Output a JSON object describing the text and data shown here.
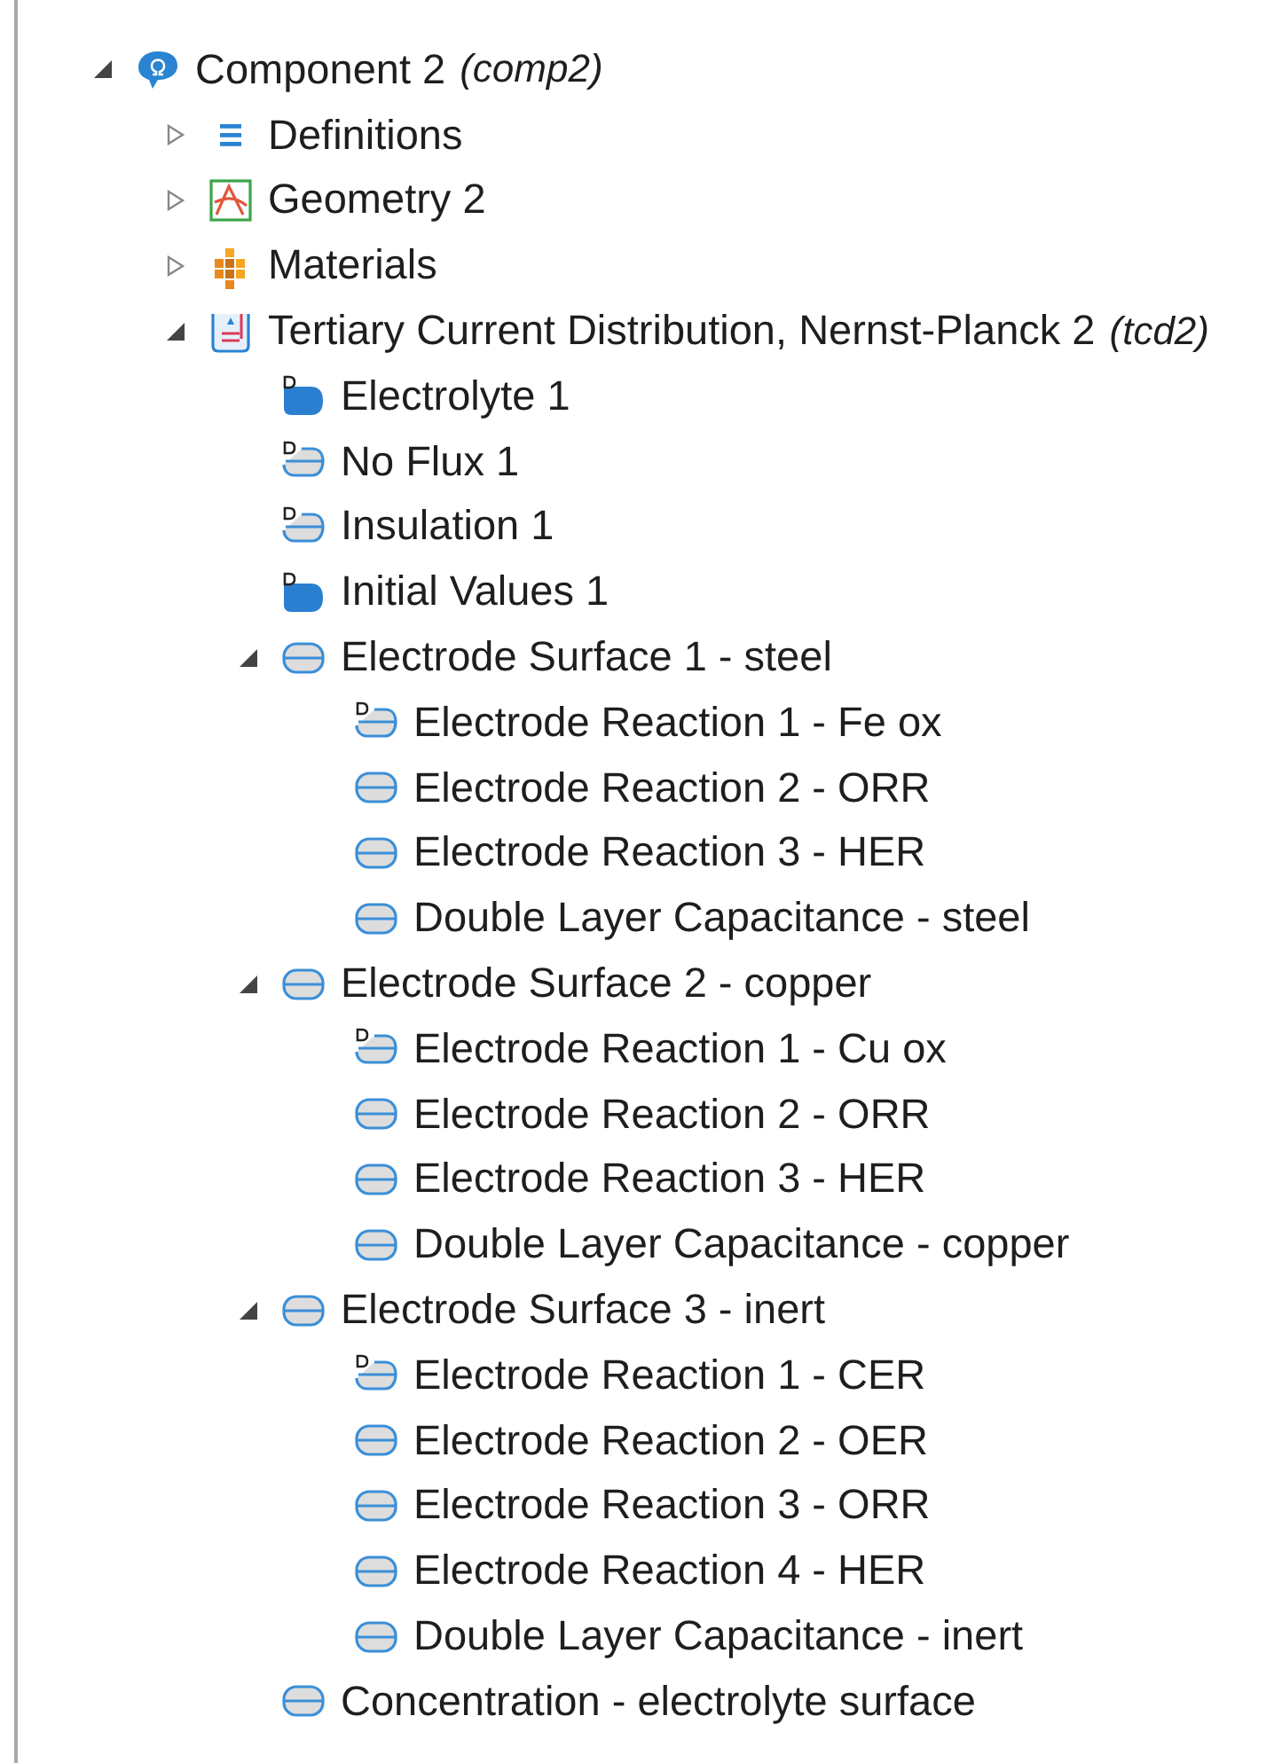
{
  "tree": [
    {
      "label": "Component 2",
      "suffix": "(comp2)",
      "kind": "component",
      "expanded": true,
      "children": [
        {
          "label": "Definitions",
          "kind": "definitions",
          "expanded": false
        },
        {
          "label": "Geometry 2",
          "kind": "geometry",
          "expanded": false
        },
        {
          "label": "Materials",
          "kind": "materials",
          "expanded": false
        },
        {
          "label": "Tertiary Current Distribution, Nernst-Planck 2",
          "suffix": "(tcd2)",
          "kind": "physics",
          "expanded": true,
          "children": [
            {
              "label": "Electrolyte 1",
              "kind": "domain-default"
            },
            {
              "label": "No Flux 1",
              "kind": "boundary-default"
            },
            {
              "label": "Insulation 1",
              "kind": "boundary-default"
            },
            {
              "label": "Initial Values 1",
              "kind": "domain-default"
            },
            {
              "label": "Electrode Surface 1 - steel",
              "kind": "boundary",
              "expanded": true,
              "children": [
                {
                  "label": "Electrode Reaction 1 - Fe ox",
                  "kind": "boundary-default"
                },
                {
                  "label": "Electrode Reaction 2 - ORR",
                  "kind": "boundary"
                },
                {
                  "label": "Electrode Reaction 3 - HER",
                  "kind": "boundary"
                },
                {
                  "label": "Double Layer Capacitance - steel",
                  "kind": "boundary"
                }
              ]
            },
            {
              "label": "Electrode Surface 2 - copper",
              "kind": "boundary",
              "expanded": true,
              "children": [
                {
                  "label": "Electrode Reaction 1 - Cu ox",
                  "kind": "boundary-default"
                },
                {
                  "label": "Electrode Reaction 2 - ORR",
                  "kind": "boundary"
                },
                {
                  "label": "Electrode Reaction 3 - HER",
                  "kind": "boundary"
                },
                {
                  "label": "Double Layer Capacitance - copper",
                  "kind": "boundary"
                }
              ]
            },
            {
              "label": "Electrode Surface 3 - inert",
              "kind": "boundary",
              "expanded": true,
              "children": [
                {
                  "label": "Electrode Reaction 1 - CER",
                  "kind": "boundary-default"
                },
                {
                  "label": "Electrode Reaction 2 - OER",
                  "kind": "boundary"
                },
                {
                  "label": "Electrode Reaction 3 - ORR",
                  "kind": "boundary"
                },
                {
                  "label": "Electrode Reaction 4 - HER",
                  "kind": "boundary"
                },
                {
                  "label": "Double Layer Capacitance - inert",
                  "kind": "boundary"
                }
              ]
            },
            {
              "label": "Concentration - electrolyte surface",
              "kind": "boundary"
            }
          ]
        }
      ]
    }
  ]
}
